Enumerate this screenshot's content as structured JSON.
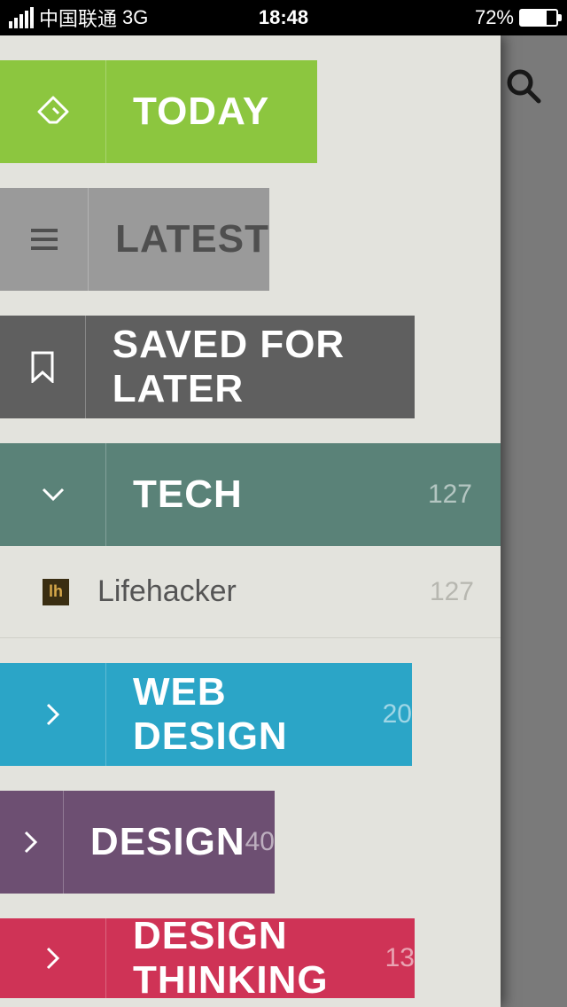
{
  "status": {
    "carrier": "中国联通",
    "network": "3G",
    "time": "18:48",
    "battery_pct": "72%"
  },
  "sidebar": {
    "today": "TODAY",
    "latest": "LATEST",
    "saved": "SAVED FOR LATER",
    "categories": [
      {
        "label": "TECH",
        "count": "127",
        "expanded": true,
        "feeds": [
          {
            "name": "Lifehacker",
            "count": "127"
          }
        ]
      },
      {
        "label": "WEB DESIGN",
        "count": "20"
      },
      {
        "label": "DESIGN",
        "count": "40"
      },
      {
        "label": "DESIGN THINKING",
        "count": "13"
      }
    ]
  }
}
